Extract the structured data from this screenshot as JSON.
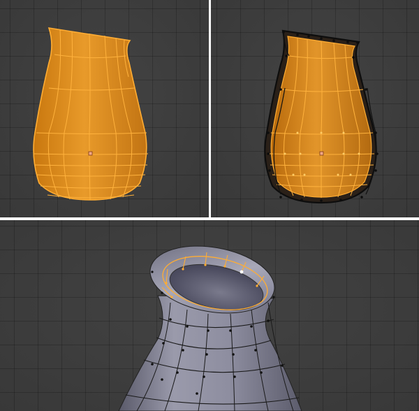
{
  "viewports": [
    {
      "id": "left",
      "mode": "edit-mesh-all-selected",
      "content": "vase-mesh"
    },
    {
      "id": "right",
      "mode": "edit-mesh-solidify",
      "content": "vase-mesh-with-thickness"
    },
    {
      "id": "bottom",
      "mode": "edit-mesh-rim-selected",
      "content": "vase-neck-closeup"
    }
  ],
  "colors": {
    "viewport_bg": "#3d3d3d",
    "grid_line": "#333333",
    "separator": "#ffffff",
    "mesh_fill": "#d98a1a",
    "selected_edge": "#ffad33",
    "unselected_edge": "#111111",
    "vertex_selected": "#ffcc66",
    "origin_dot": "#f5a886",
    "shaded_surface": "#8c8ca0",
    "active_vertex": "#ffffff"
  },
  "icons": [
    "origin-dot-icon",
    "active-vertex-icon"
  ]
}
